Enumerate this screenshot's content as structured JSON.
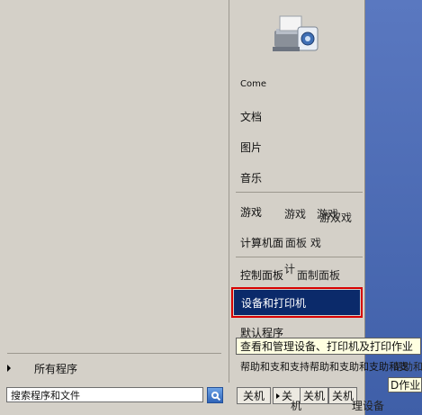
{
  "left": {
    "all_programs": "所有程序",
    "search_placeholder": "搜索程序和文件"
  },
  "right": {
    "user_name": "Come",
    "items": [
      "文档",
      "图片",
      "音乐",
      "游戏",
      "计算机面",
      "控制面板",
      "设备和打印机",
      "默认程序"
    ],
    "help_row": "帮助和支和支持帮助和支助和支助和支"
  },
  "ghosts": {
    "games2": "游戏",
    "games3": "游戏",
    "games4": "游双戏",
    "computer_tail": "面板 戏",
    "control_tail": "计",
    "control_tail2": "面制面板",
    "help_tail": "帮助和"
  },
  "tooltip": "查看和管理设备、打印机及打印作业",
  "tooltip_fragment": "D作业",
  "shutdown": {
    "label": "关机",
    "arrow_label": "关",
    "ghost1": "关机",
    "ghost2": "关机",
    "devices_fragment": "理设备",
    "ghost_ji": "机"
  }
}
